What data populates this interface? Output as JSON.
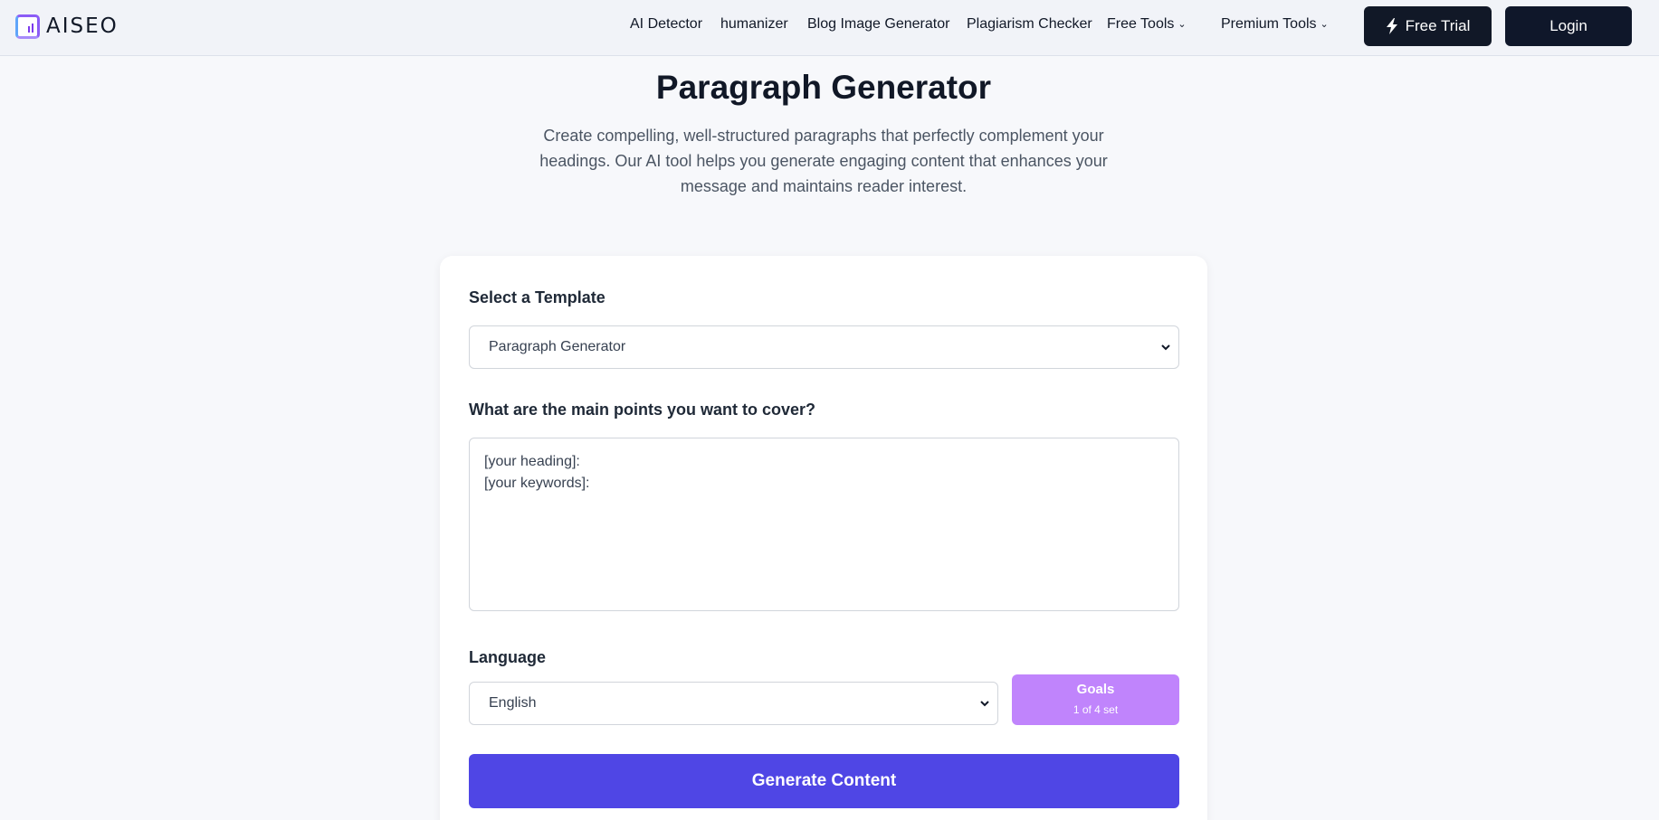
{
  "header": {
    "logo_text": "AISEO",
    "nav": [
      {
        "label": "AI Detector"
      },
      {
        "label": "humanizer"
      },
      {
        "label": "Blog Image Generator"
      },
      {
        "label": "Plagiarism Checker"
      },
      {
        "label": "Free Tools",
        "dropdown": true
      },
      {
        "label": "Premium Tools",
        "dropdown": true
      }
    ],
    "trial_label": "Free Trial",
    "login_label": "Login"
  },
  "hero": {
    "title": "Paragraph Generator",
    "description": "Create compelling, well-structured paragraphs that perfectly complement your headings. Our AI tool helps you generate engaging content that enhances your message and maintains reader interest."
  },
  "form": {
    "template_label": "Select a Template",
    "template_value": "Paragraph Generator",
    "points_label": "What are the main points you want to cover?",
    "points_value": "[your heading]:\n[your keywords]:",
    "language_label": "Language",
    "language_value": "English",
    "goals_title": "Goals",
    "goals_status": "1 of 4 set",
    "generate_label": "Generate Content"
  },
  "colors": {
    "primary": "#4f46e5",
    "goals": "#c084fc",
    "dark_button": "#111827"
  },
  "icons": {
    "logo": "aiseo-logo-icon",
    "trial": "lightning-icon",
    "dropdown": "chevron-down-icon"
  }
}
